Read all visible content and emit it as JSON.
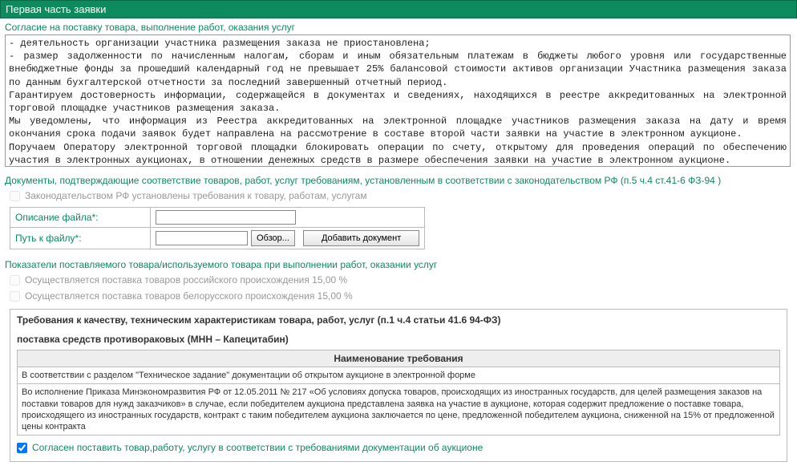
{
  "header": "Первая часть заявки",
  "consent": {
    "title": "Согласие на поставку товара, выполнение работ, оказания услуг",
    "body": "- деятельность организации участника размещения заказа не приостановлена;\n- размер задолженности по начисленным налогам, сборам и иным обязательным платежам в бюджеты любого уровня или государственные внебюджетные фонды за прошедший календарный год не превышает 25% балансовой стоимости активов организации Участника размещения заказа по данным бухгалтерской отчетности за последний завершенный отчетный период.\nГарантируем достоверность информации, содержащейся в документах и сведениях, находящихся в реестре аккредитованных на электронной торговой площадке участников размещения заказа.\nМы уведомлены, что информация из Реестра аккредитованных на электронной площадке участников размещения заказа на дату и время окончания срока подачи заявок будет направлена на рассмотрение в составе второй части заявки на участие в электронном аукционе.\nПоручаем Оператору электронной торговой площадки блокировать операции по счету, открытому для проведения операций по обеспечению участия в электронных аукционах, в отношении денежных средств в размере обеспечения заявки на участие в электронном аукционе."
  },
  "documents": {
    "title": "Документы, подтверждающие соответствие товаров, работ, услуг требованиям, установленным в соответствии с законодательством РФ (п.5 ч.4 ст.41-6 ФЗ-94 )",
    "disabled_check": "Законодательством РФ установлены требования к товару, работам, услугам",
    "file_desc_label": "Описание файла*:",
    "file_path_label": "Путь к файлу*:",
    "browse": "Обзор...",
    "add": "Добавить документ"
  },
  "indicators": {
    "title": "Показатели поставляемого товара/используемого товара при выполнении работ, оказании услуг",
    "russian": "Осуществляется поставка товаров российского происхождения 15,00 %",
    "belarus": "Осуществляется поставка товаров белорусского происхождения 15,00 %"
  },
  "requirements": {
    "heading": "Требования к качеству, техническим характеристикам товара, работ, услуг (п.1 ч.4 статьи 41.6 94-ФЗ)",
    "subheading": "поставка средств противораковых (МНН – Капецитабин)",
    "column": "Наименование требования",
    "rows": [
      "В соответствии с разделом \"Техническое задание\" документации об открытом аукционе в электронной форме",
      "Во исполнение Приказа Минэкономразвития РФ от 12.05.2011 № 217 «Об условиях допуска товаров, происходящих из иностранных государств, для целей размещения заказов на поставки товаров для нужд заказчиков» в случае, если победителем аукциона представлена заявка на участие в аукционе, которая содержит предложение о поставке товара, происходящего из иностранных государств, контракт с таким победителем аукциона заключается по цене, предложенной победителем аукциона, сниженной на 15% от предложенной цены контракта"
    ],
    "agree": "Согласен поставить товар,работу, услугу в соответствии с требованиями документации об аукционе"
  }
}
